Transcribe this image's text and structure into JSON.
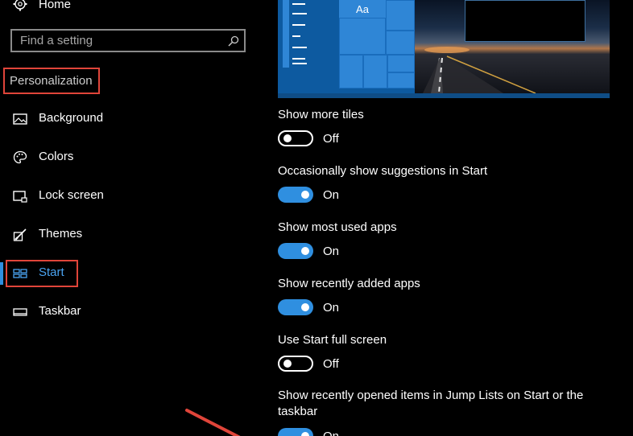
{
  "sidebar": {
    "home_label": "Home",
    "search_placeholder": "Find a setting",
    "section_title": "Personalization",
    "items": [
      {
        "label": "Background",
        "icon": "picture-icon"
      },
      {
        "label": "Colors",
        "icon": "palette-icon"
      },
      {
        "label": "Lock screen",
        "icon": "lock-screen-icon"
      },
      {
        "label": "Themes",
        "icon": "themes-brush-icon"
      },
      {
        "label": "Start",
        "icon": "start-tiles-icon",
        "selected": true
      },
      {
        "label": "Taskbar",
        "icon": "taskbar-icon"
      }
    ]
  },
  "preview": {
    "tile_text": "Aa"
  },
  "settings": [
    {
      "label": "Show more tiles",
      "state": "Off"
    },
    {
      "label": "Occasionally show suggestions in Start",
      "state": "On"
    },
    {
      "label": "Show most used apps",
      "state": "On"
    },
    {
      "label": "Show recently added apps",
      "state": "On"
    },
    {
      "label": "Use Start full screen",
      "state": "Off"
    },
    {
      "label": "Show recently opened items in Jump Lists on Start or the taskbar",
      "state": "On"
    }
  ],
  "colors": {
    "accent": "#2f8fe0",
    "highlight_box": "#e0453a",
    "selected_text": "#4aa3f0"
  }
}
